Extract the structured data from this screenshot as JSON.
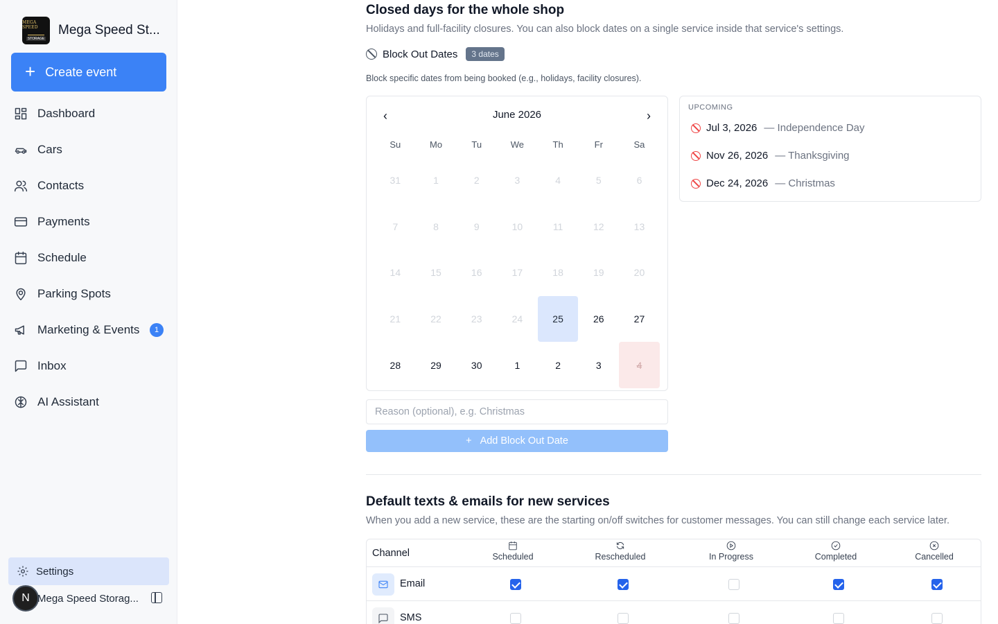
{
  "sidebar": {
    "brand": {
      "name": "Mega Speed St...",
      "logo_text_top": "MEGA SPEED",
      "logo_text_bottom": "STORAGE"
    },
    "create_label": "Create event",
    "nav": [
      {
        "label": "Dashboard",
        "icon": "dashboard-icon"
      },
      {
        "label": "Cars",
        "icon": "car-icon"
      },
      {
        "label": "Contacts",
        "icon": "contacts-icon"
      },
      {
        "label": "Payments",
        "icon": "credit-card-icon"
      },
      {
        "label": "Schedule",
        "icon": "calendar-icon"
      },
      {
        "label": "Parking Spots",
        "icon": "map-pin-icon"
      },
      {
        "label": "Marketing & Events",
        "icon": "megaphone-icon",
        "badge": "1"
      },
      {
        "label": "Inbox",
        "icon": "message-icon"
      },
      {
        "label": "AI Assistant",
        "icon": "brain-icon"
      }
    ],
    "settings_label": "Settings",
    "user": {
      "initial": "N",
      "name": "Mega Speed Storag..."
    }
  },
  "closed_days": {
    "title": "Closed days for the whole shop",
    "subtitle": "Holidays and full-facility closures. You can also block dates on a single service inside that service's settings.",
    "block_label": "Block Out Dates",
    "count_badge": "3 dates",
    "hint": "Block specific dates from being booked (e.g., holidays, facility closures).",
    "calendar": {
      "month": "June 2026",
      "weekdays": [
        "Su",
        "Mo",
        "Tu",
        "We",
        "Th",
        "Fr",
        "Sa"
      ],
      "days": [
        {
          "d": "31",
          "s": "muted"
        },
        {
          "d": "1",
          "s": "muted"
        },
        {
          "d": "2",
          "s": "muted"
        },
        {
          "d": "3",
          "s": "muted"
        },
        {
          "d": "4",
          "s": "muted"
        },
        {
          "d": "5",
          "s": "muted"
        },
        {
          "d": "6",
          "s": "muted"
        },
        {
          "d": "7",
          "s": "muted"
        },
        {
          "d": "8",
          "s": "muted"
        },
        {
          "d": "9",
          "s": "muted"
        },
        {
          "d": "10",
          "s": "muted"
        },
        {
          "d": "11",
          "s": "muted"
        },
        {
          "d": "12",
          "s": "muted"
        },
        {
          "d": "13",
          "s": "muted"
        },
        {
          "d": "14",
          "s": "muted"
        },
        {
          "d": "15",
          "s": "muted"
        },
        {
          "d": "16",
          "s": "muted"
        },
        {
          "d": "17",
          "s": "muted"
        },
        {
          "d": "18",
          "s": "muted"
        },
        {
          "d": "19",
          "s": "muted"
        },
        {
          "d": "20",
          "s": "muted"
        },
        {
          "d": "21",
          "s": "muted"
        },
        {
          "d": "22",
          "s": "muted"
        },
        {
          "d": "23",
          "s": "muted"
        },
        {
          "d": "24",
          "s": "muted"
        },
        {
          "d": "25",
          "s": "sel"
        },
        {
          "d": "26",
          "s": "active"
        },
        {
          "d": "27",
          "s": "active"
        },
        {
          "d": "28",
          "s": "active"
        },
        {
          "d": "29",
          "s": "active"
        },
        {
          "d": "30",
          "s": "active"
        },
        {
          "d": "1",
          "s": "active"
        },
        {
          "d": "2",
          "s": "active"
        },
        {
          "d": "3",
          "s": "active"
        },
        {
          "d": "4",
          "s": "blocked"
        }
      ]
    },
    "upcoming_title": "UPCOMING",
    "upcoming": [
      {
        "date": "Jul 3, 2026",
        "reason": "— Independence Day"
      },
      {
        "date": "Nov 26, 2026",
        "reason": "— Thanksgiving"
      },
      {
        "date": "Dec 24, 2026",
        "reason": "— Christmas"
      }
    ],
    "reason_placeholder": "Reason (optional), e.g. Christmas",
    "add_label": "Add Block Out Date"
  },
  "defaults": {
    "title": "Default texts & emails for new services",
    "subtitle": "When you add a new service, these are the starting on/off switches for customer messages. You can still change each service later.",
    "channel_header": "Channel",
    "columns": [
      {
        "label": "Scheduled",
        "icon": "calendar-icon"
      },
      {
        "label": "Rescheduled",
        "icon": "refresh-icon"
      },
      {
        "label": "In Progress",
        "icon": "play-circle-icon"
      },
      {
        "label": "Completed",
        "icon": "check-circle-icon"
      },
      {
        "label": "Cancelled",
        "icon": "x-circle-icon"
      }
    ],
    "rows": [
      {
        "label": "Email",
        "icon": "mail-icon",
        "checks": [
          true,
          true,
          false,
          true,
          true
        ]
      },
      {
        "label": "SMS",
        "icon": "chat-icon",
        "checks": [
          false,
          false,
          false,
          false,
          false
        ]
      }
    ]
  },
  "colors": {
    "accent": "#3b82f6",
    "blocked": "#ef4444",
    "selected_bg": "#dbe7fd"
  }
}
